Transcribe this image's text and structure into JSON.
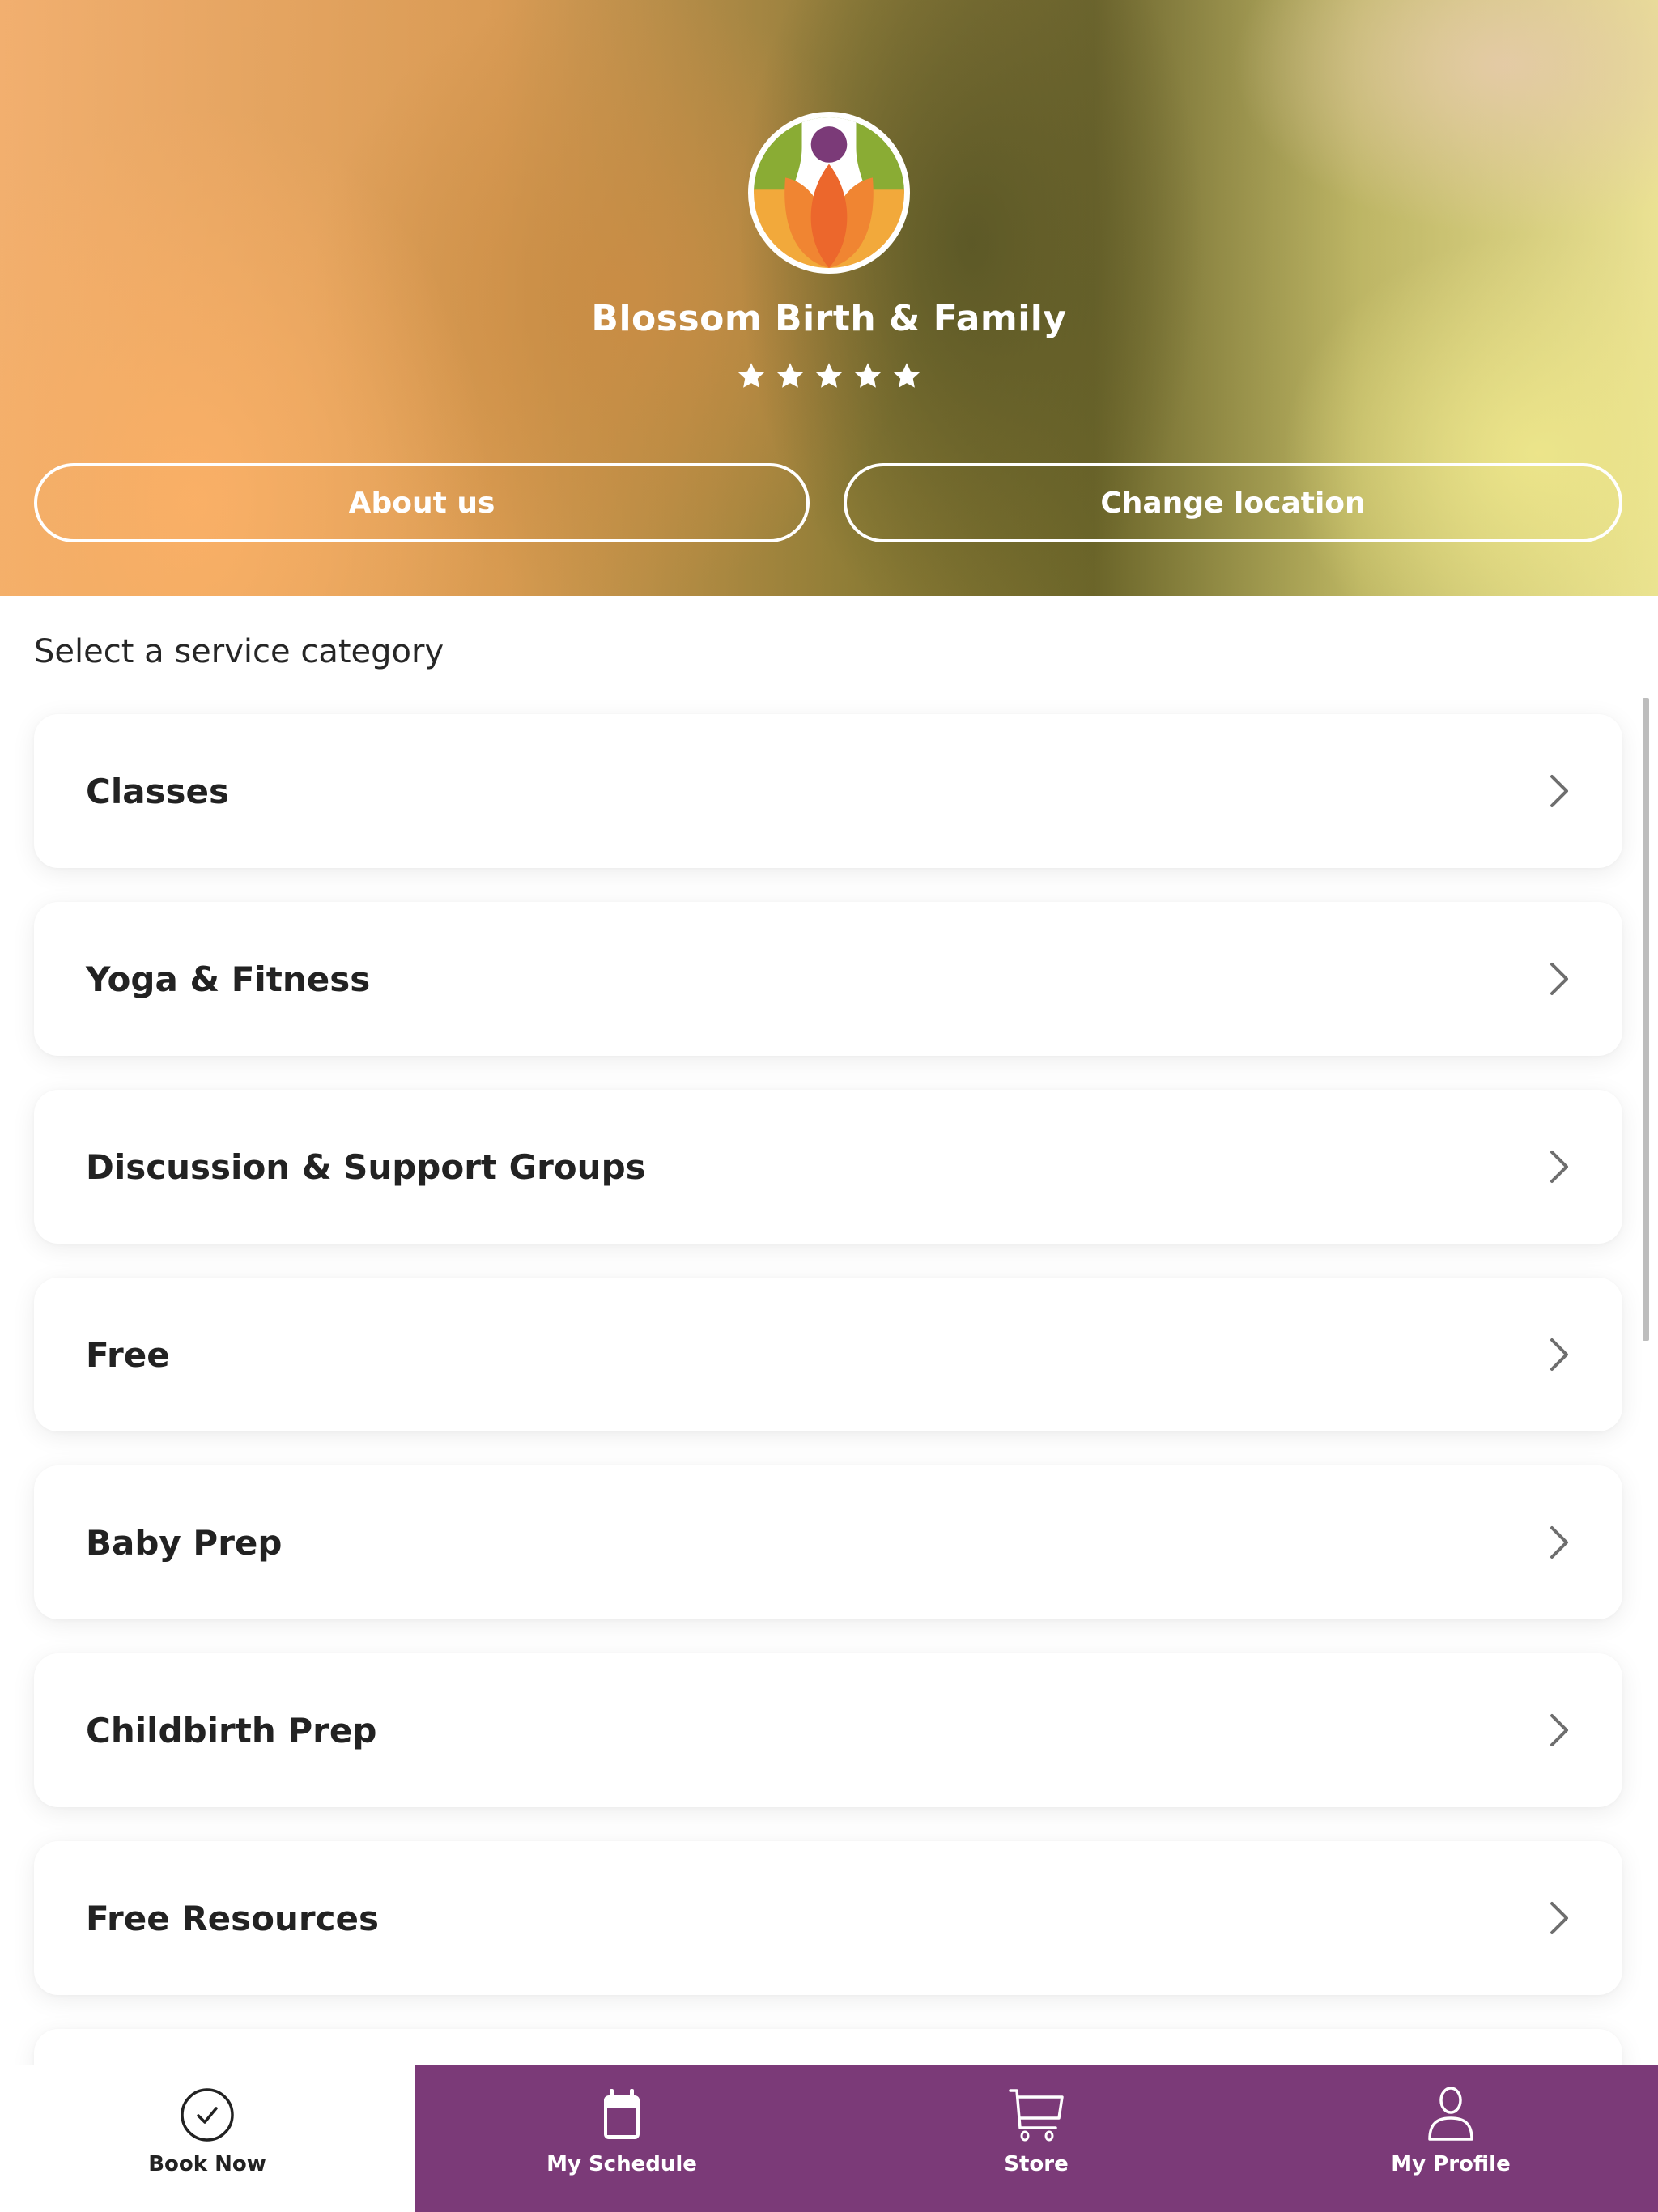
{
  "business": {
    "name": "Blossom Birth & Family",
    "rating": 5,
    "rating_max": 5
  },
  "hero_buttons": {
    "about": "About us",
    "change_location": "Change location"
  },
  "section_title": "Select a service category",
  "categories": [
    {
      "label": "Classes",
      "icon": "chevron-right-icon"
    },
    {
      "label": "Yoga & Fitness",
      "icon": "chevron-right-icon"
    },
    {
      "label": "Discussion & Support Groups",
      "icon": "chevron-right-icon"
    },
    {
      "label": "Free",
      "icon": "chevron-right-icon"
    },
    {
      "label": "Baby Prep",
      "icon": "chevron-right-icon"
    },
    {
      "label": "Childbirth Prep",
      "icon": "chevron-right-icon"
    },
    {
      "label": "Free Resources",
      "icon": "chevron-right-icon"
    },
    {
      "label": "",
      "icon": "chevron-right-icon"
    }
  ],
  "tabs": [
    {
      "label": "Book Now",
      "icon": "check-circle-icon",
      "active": true
    },
    {
      "label": "My Schedule",
      "icon": "calendar-icon",
      "active": false
    },
    {
      "label": "Store",
      "icon": "cart-icon",
      "active": false
    },
    {
      "label": "My Profile",
      "icon": "user-icon",
      "active": false
    }
  ],
  "colors": {
    "brand_purple": "#7b3a78",
    "logo_green": "#8aac34",
    "logo_orange": "#ef6a2c",
    "logo_light_orange": "#f2a93b",
    "logo_purple": "#7b3a78",
    "text_dark": "#222222",
    "chevron": "#6e6e6e"
  }
}
